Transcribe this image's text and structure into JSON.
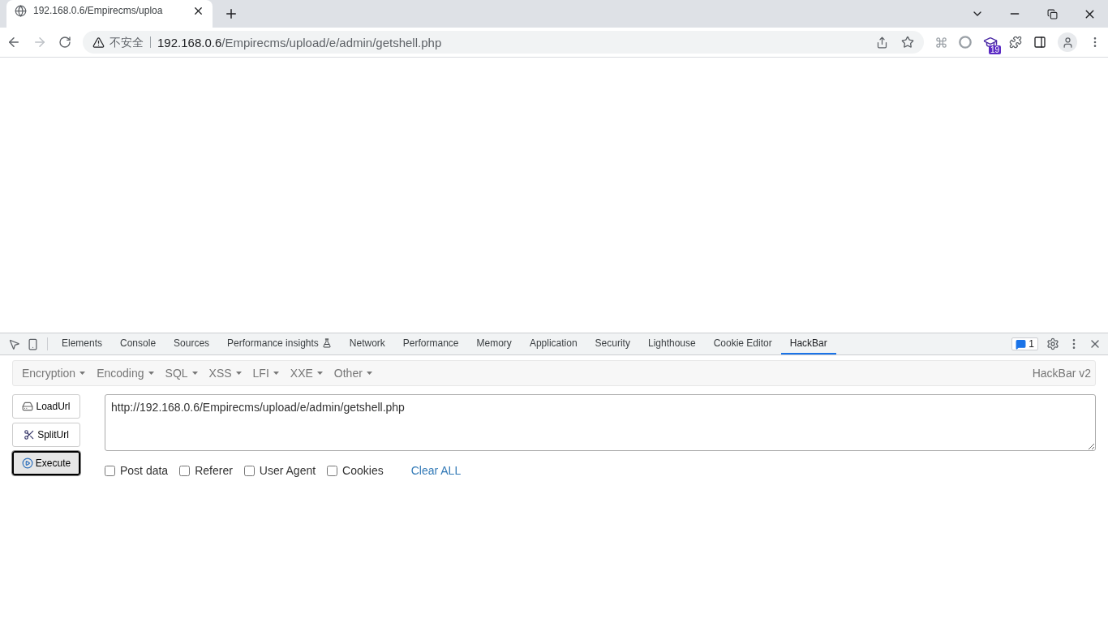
{
  "browser": {
    "tab": {
      "title": "192.168.0.6/Empirecms/uploa",
      "selected": true
    },
    "address": {
      "security_label": "不安全",
      "host": "192.168.0.6",
      "path": "/Empirecms/upload/e/admin/getshell.php"
    },
    "extension_badge": "19"
  },
  "devtools": {
    "tabs": [
      {
        "label": "Elements",
        "selected": false
      },
      {
        "label": "Console",
        "selected": false
      },
      {
        "label": "Sources",
        "selected": false
      },
      {
        "label": "Performance insights",
        "selected": false,
        "experimental": true
      },
      {
        "label": "Network",
        "selected": false
      },
      {
        "label": "Performance",
        "selected": false
      },
      {
        "label": "Memory",
        "selected": false
      },
      {
        "label": "Application",
        "selected": false
      },
      {
        "label": "Security",
        "selected": false
      },
      {
        "label": "Lighthouse",
        "selected": false
      },
      {
        "label": "Cookie Editor",
        "selected": false
      },
      {
        "label": "HackBar",
        "selected": true
      }
    ],
    "issues_count": "1"
  },
  "hackbar": {
    "menus": [
      "Encryption",
      "Encoding",
      "SQL",
      "XSS",
      "LFI",
      "XXE",
      "Other"
    ],
    "version": "HackBar v2",
    "buttons": [
      {
        "label": "LoadUrl",
        "kind": "load",
        "focused": false
      },
      {
        "label": "SplitUrl",
        "kind": "split",
        "focused": false
      },
      {
        "label": "Execute",
        "kind": "execute",
        "focused": true
      }
    ],
    "url_value": "http://192.168.0.6/Empirecms/upload/e/admin/getshell.php",
    "options": [
      {
        "label": "Post data",
        "checked": false
      },
      {
        "label": "Referer",
        "checked": false
      },
      {
        "label": "User Agent",
        "checked": false
      },
      {
        "label": "Cookies",
        "checked": false
      }
    ],
    "clear_link": "Clear ALL"
  }
}
